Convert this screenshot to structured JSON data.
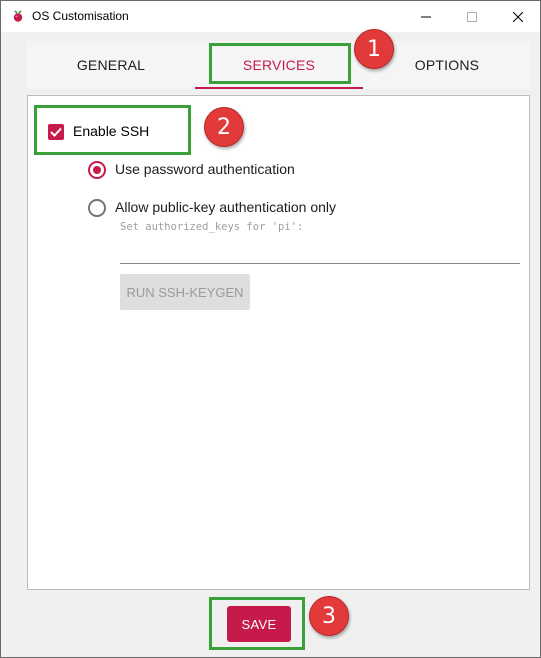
{
  "window": {
    "title": "OS Customisation",
    "icons": {
      "app": "raspberry-icon",
      "minimize": "minimize-icon",
      "maximize": "maximize-icon",
      "close": "close-icon"
    }
  },
  "tabs": [
    {
      "label": "GENERAL",
      "active": false
    },
    {
      "label": "SERVICES",
      "active": true
    },
    {
      "label": "OPTIONS",
      "active": false
    }
  ],
  "services": {
    "enable_ssh": {
      "label": "Enable SSH",
      "checked": true
    },
    "auth_options": [
      {
        "label": "Use password authentication",
        "selected": true
      },
      {
        "label": "Allow public-key authentication only",
        "selected": false
      }
    ],
    "authorized_keys": {
      "label": "Set authorized_keys for 'pi':",
      "value": ""
    },
    "keygen_button": {
      "label": "RUN SSH-KEYGEN",
      "enabled": false
    }
  },
  "footer": {
    "save_label": "SAVE"
  },
  "annotations": {
    "badges": [
      "1",
      "2",
      "3"
    ],
    "highlight_color": "#3aa13a",
    "badge_color": "#e23a3a"
  },
  "colors": {
    "accent": "#c51a4a"
  }
}
